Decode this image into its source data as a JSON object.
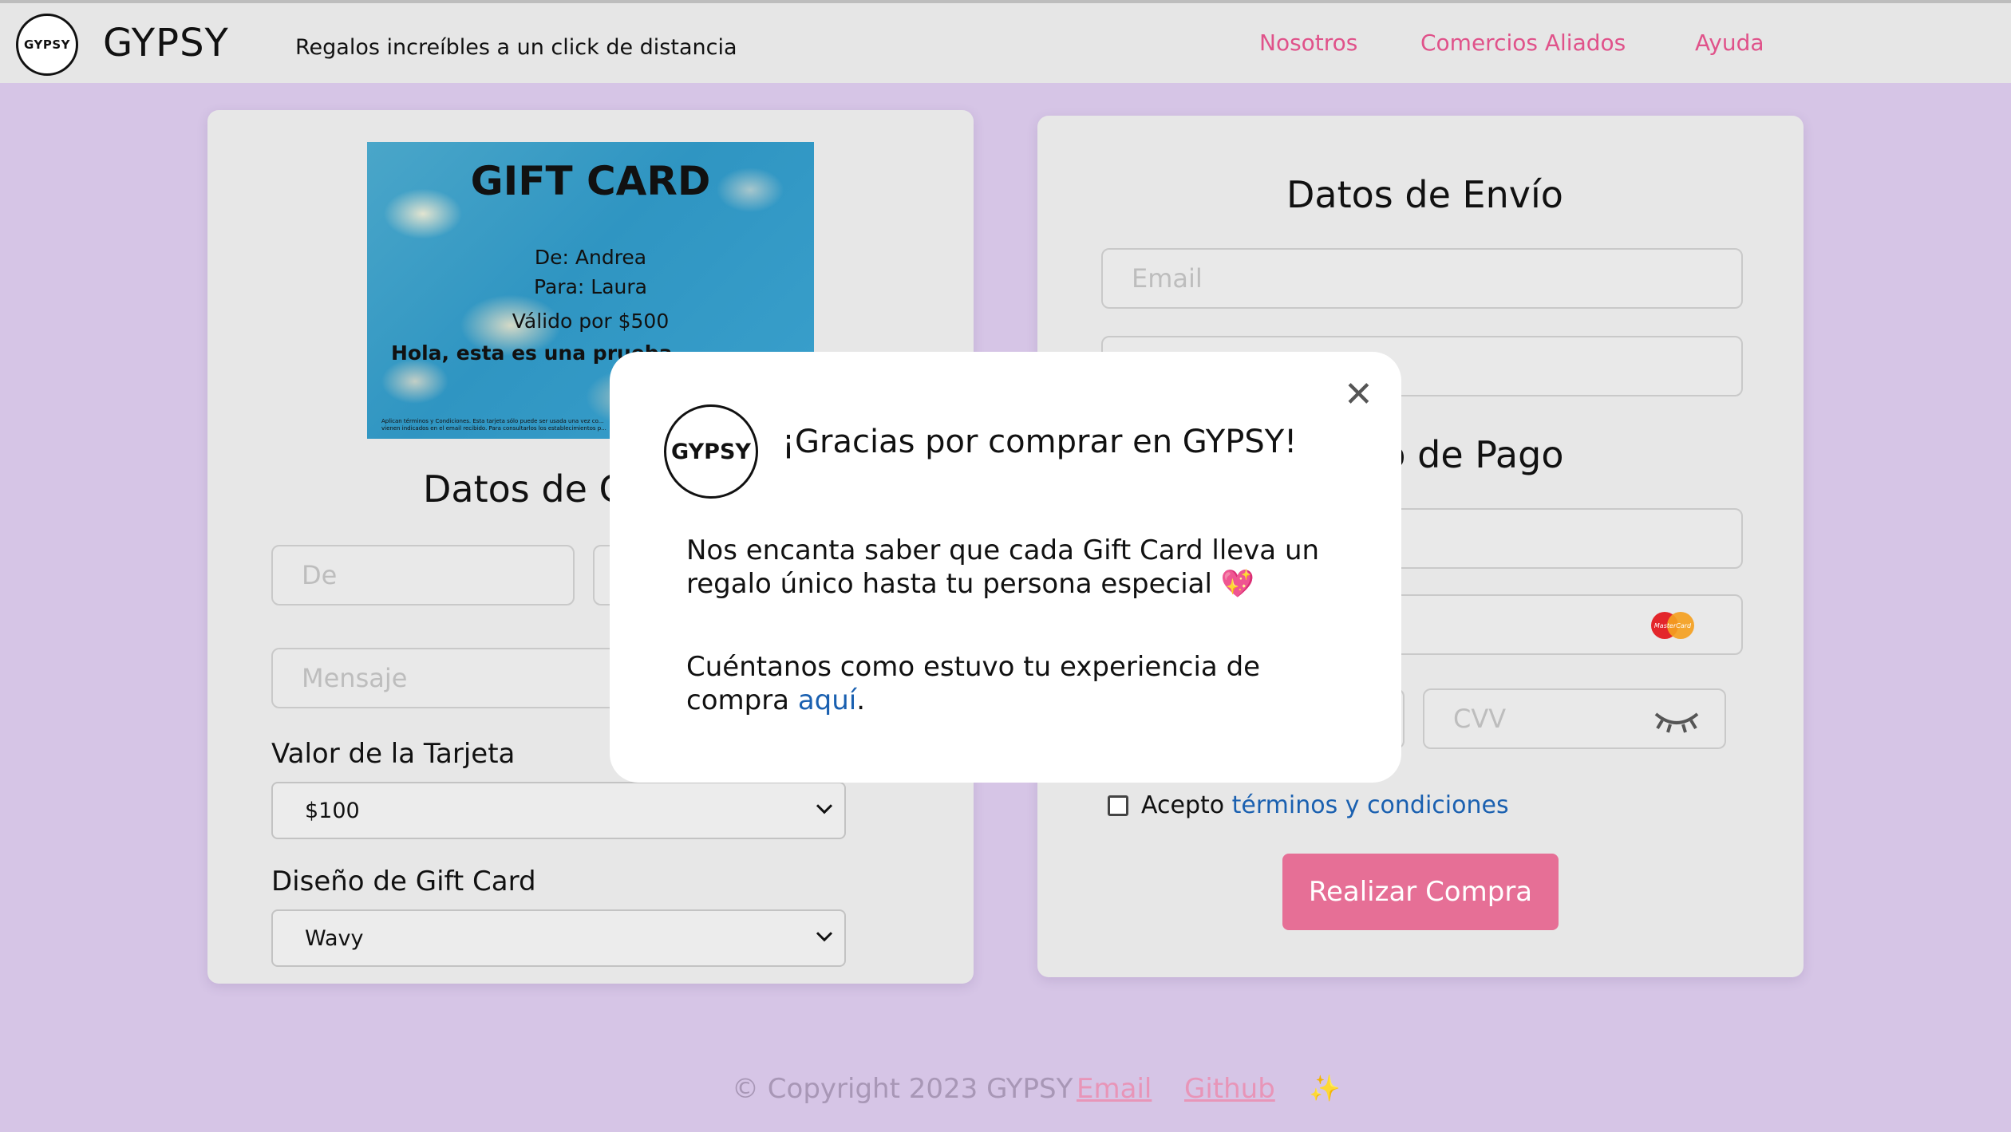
{
  "header": {
    "logo_text": "GYPSY",
    "brand": "GYPSY",
    "tagline": "Regalos increíbles a un click de distancia",
    "nav": [
      "Nosotros",
      "Comercios Aliados",
      "Ayuda"
    ]
  },
  "gift_card": {
    "title": "GIFT CARD",
    "from": "De: Andrea",
    "to": "Para: Laura",
    "value": "Válido por $500",
    "message": "Hola, esta es una prueba",
    "fine_print": "Aplican términos y Condiciones. Esta tarjeta sólo puede ser usada una vez co... vienen indicados en el email recibido. Para consultarlos los establecimientos p..."
  },
  "left_form": {
    "title": "Datos de Gift Card",
    "from_placeholder": "De",
    "message_placeholder": "Mensaje",
    "value_label": "Valor de la Tarjeta",
    "value_selected": "$100",
    "design_label": "Diseño de Gift Card",
    "design_selected": "Wavy"
  },
  "right_form": {
    "shipping_title": "Datos de Envío",
    "email_placeholder": "Email",
    "payment_title": "Método de Pago",
    "cvv_placeholder": "CVV",
    "card_brand": "MasterCard",
    "accept_text": "Acepto",
    "terms_link": "términos y condiciones",
    "submit": "Realizar Compra"
  },
  "modal": {
    "logo_text": "GYPSY",
    "title": "¡Gracias por comprar en GYPSY!",
    "paragraph1": "Nos encanta saber que cada Gift Card lleva un regalo único hasta tu persona especial",
    "heart_emoji": "💖",
    "paragraph2_prefix": "Cuéntanos como estuvo tu experiencia de compra",
    "paragraph2_link": "aquí",
    "paragraph2_suffix": ".",
    "close_glyph": "✕"
  },
  "footer": {
    "copyright": "© Copyright 2023 GYPSY",
    "links": [
      "Email",
      "Github"
    ],
    "sparkle": "✨"
  },
  "colors": {
    "background": "#d6c5e6",
    "accent_pink": "#e66f96",
    "link_blue": "#1a60b0"
  }
}
